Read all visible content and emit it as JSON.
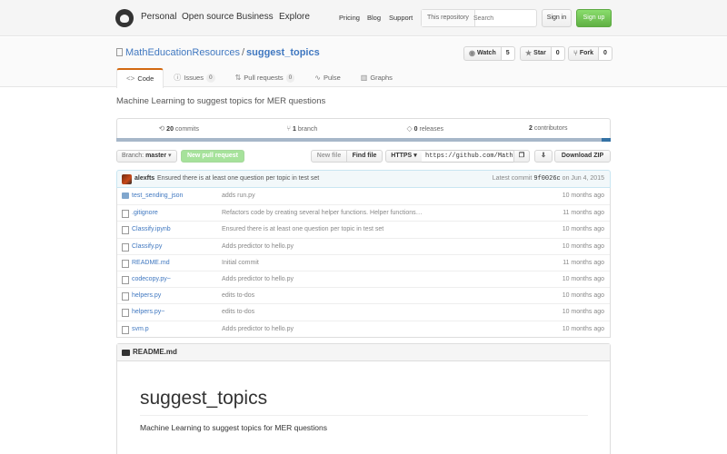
{
  "header": {
    "nav": [
      "Personal",
      "Open source",
      "Business",
      "Explore"
    ],
    "links": [
      "Pricing",
      "Blog",
      "Support"
    ],
    "search_scope": "This repository",
    "search_placeholder": "Search",
    "signin_label": "Sign in",
    "signup_label": "Sign up"
  },
  "repo": {
    "owner": "MathEducationResources",
    "separator": "/",
    "name": "suggest_topics",
    "watch": {
      "label": "Watch",
      "count": "5"
    },
    "star": {
      "label": "Star",
      "count": "0"
    },
    "fork": {
      "label": "Fork",
      "count": "0"
    },
    "tabs": [
      {
        "label": "Code",
        "icon": "code-icon"
      },
      {
        "label": "Issues",
        "count": "0",
        "icon": "issue-icon"
      },
      {
        "label": "Pull requests",
        "count": "0",
        "icon": "pull-request-icon"
      },
      {
        "label": "Pulse",
        "icon": "pulse-icon"
      },
      {
        "label": "Graphs",
        "icon": "graph-icon"
      }
    ],
    "description": "Machine Learning to suggest topics for MER questions"
  },
  "summary": {
    "commits_num": "20",
    "commits_label": "commits",
    "branches_num": "1",
    "branches_label": "branch",
    "releases_num": "0",
    "releases_label": "releases",
    "contributors_num": "2",
    "contributors_label": "contributors"
  },
  "filebar": {
    "branch_prefix": "Branch:",
    "branch_name": "master",
    "new_pr_label": "New pull request",
    "new_file_label": "New file",
    "find_file_label": "Find file",
    "protocol": "HTTPS",
    "clone_url": "https://github.com/Math",
    "download_zip_label": "Download ZIP"
  },
  "latest_commit": {
    "author": "alexfts",
    "message": "Ensured there is at least one question per topic in test set",
    "prefix": "Latest commit",
    "sha": "9f0026c",
    "date": "on Jun 4, 2015"
  },
  "files": [
    {
      "type": "dir",
      "name": "test_sending_json",
      "message": "adds run.py",
      "age": "10 months ago"
    },
    {
      "type": "file",
      "name": ".gitignore",
      "message": "Refactors code by creating several helper functions. Helper functions…",
      "age": "11 months ago"
    },
    {
      "type": "file",
      "name": "Classify.ipynb",
      "message": "Ensured there is at least one question per topic in test set",
      "age": "10 months ago"
    },
    {
      "type": "file",
      "name": "Classify.py",
      "message": "Adds predictor to hello.py",
      "age": "10 months ago"
    },
    {
      "type": "file",
      "name": "README.md",
      "message": "Initial commit",
      "age": "11 months ago"
    },
    {
      "type": "file",
      "name": "codecopy.py~",
      "message": "Adds predictor to hello.py",
      "age": "10 months ago"
    },
    {
      "type": "file",
      "name": "helpers.py",
      "message": "edits to-dos",
      "age": "10 months ago"
    },
    {
      "type": "file",
      "name": "helpers.py~",
      "message": "edits to-dos",
      "age": "10 months ago"
    },
    {
      "type": "file",
      "name": "svm.p",
      "message": "Adds predictor to hello.py",
      "age": "10 months ago"
    }
  ],
  "readme": {
    "filename": "README.md",
    "title": "suggest_topics",
    "body": "Machine Learning to suggest topics for MER questions"
  },
  "colors": {
    "accent_link": "#4078c0",
    "signup_green": "#60b044",
    "tab_selected_border": "#d26911",
    "language_bar": "#3572a5"
  }
}
